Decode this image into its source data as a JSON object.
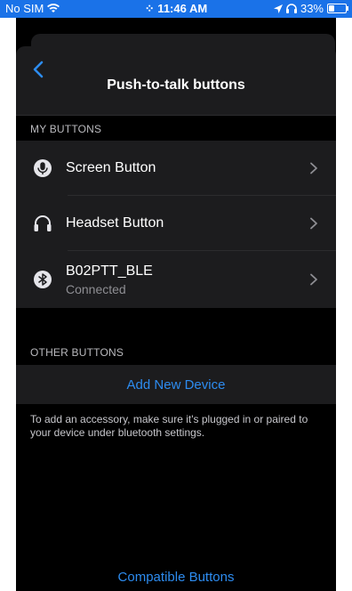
{
  "status_bar": {
    "carrier": "No SIM",
    "time": "⁘ 11:46 AM",
    "battery": "33%",
    "battery_level": 0.33
  },
  "header": {
    "title": "Push-to-talk buttons"
  },
  "my_buttons": {
    "section_label": "MY BUTTONS",
    "items": [
      {
        "label": "Screen Button",
        "icon": "microphone-icon"
      },
      {
        "label": "Headset Button",
        "icon": "headset-icon"
      },
      {
        "label": "B02PTT_BLE",
        "sublabel": "Connected",
        "icon": "bluetooth-icon"
      }
    ]
  },
  "other_buttons": {
    "section_label": "OTHER BUTTONS",
    "add_label": "Add New Device",
    "hint": "To add an accessory, make sure it's plugged in or paired to your device under bluetooth settings."
  },
  "footer": {
    "compatible_label": "Compatible Buttons"
  },
  "colors": {
    "status_bar": "#1a72e8",
    "background": "#000000",
    "cell": "#1c1c1e",
    "accent": "#2d8cf0"
  }
}
